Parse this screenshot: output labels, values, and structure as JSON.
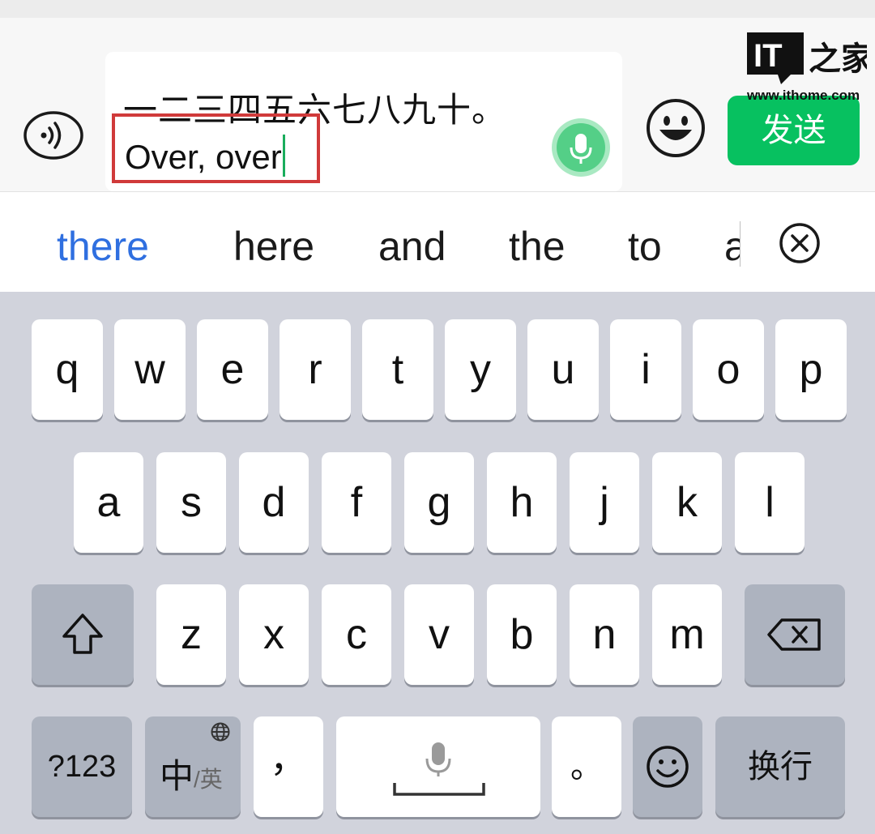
{
  "input_bar": {
    "line1": "一二三四五六七八九十。",
    "line2": "Over, over",
    "send_label": "发送"
  },
  "watermark": {
    "logo_text": "IT之家",
    "site": "www.ithome.com"
  },
  "suggestions": [
    "there",
    "here",
    "and",
    "the",
    "to",
    "a"
  ],
  "keyboard": {
    "row1": [
      "q",
      "w",
      "e",
      "r",
      "t",
      "y",
      "u",
      "i",
      "o",
      "p"
    ],
    "row2": [
      "a",
      "s",
      "d",
      "f",
      "g",
      "h",
      "j",
      "k",
      "l"
    ],
    "row3": [
      "z",
      "x",
      "c",
      "v",
      "b",
      "n",
      "m"
    ],
    "bottom": {
      "numbers": "?123",
      "lang_main": "中",
      "lang_alt": "/英",
      "comma": "，",
      "period": "。",
      "enter": "换行"
    }
  },
  "colors": {
    "send_green": "#07c160",
    "caret_green": "#1aad5c",
    "highlight_red": "#d03a3a",
    "suggest_blue": "#2f6fe0"
  }
}
